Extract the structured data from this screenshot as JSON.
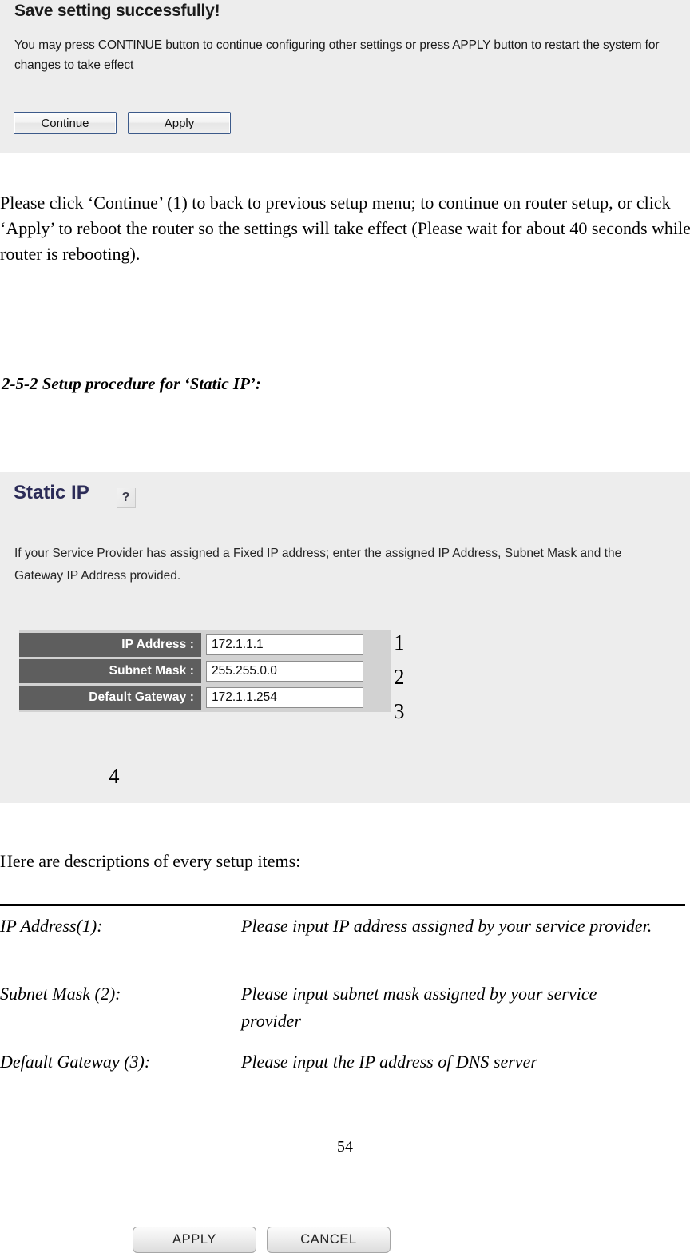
{
  "save_panel": {
    "title": "Save setting successfully!",
    "description": "You may press CONTINUE button to continue configuring other settings or press APPLY button to restart the system for changes to take effect",
    "continue_label": "Continue",
    "apply_label": "Apply"
  },
  "document": {
    "paragraph_continue": "Please click ‘Continue’ (1) to back to previous setup menu; to continue on router setup, or click ‘Apply’ to reboot the router so the settings will take effect (Please wait for about 40 seconds while router is rebooting).",
    "heading": "2-5-2 Setup procedure for ‘Static IP’:",
    "paragraph_here": "Here are descriptions of every setup items:",
    "page_number": "54"
  },
  "static_panel": {
    "title": "Static IP",
    "help_icon_glyph": "?",
    "description": "If your Service Provider has assigned a Fixed IP address; enter the assigned IP Address, Subnet Mask and the Gateway IP Address provided.",
    "fields": [
      {
        "label": "IP Address :",
        "value": "172.1.1.1",
        "annotation": "1"
      },
      {
        "label": "Subnet Mask :",
        "value": "255.255.0.0",
        "annotation": "2"
      },
      {
        "label": "Default Gateway :",
        "value": "172.1.1.254",
        "annotation": "3"
      }
    ],
    "apply_label": "APPLY",
    "cancel_label": "CANCEL",
    "buttons_annotation": "4",
    "colors": {
      "panel_background": "#ededed",
      "label_background": "#5e5e5e",
      "label_text": "#ffffff",
      "title_text": "#2c2c58",
      "input_background": "#ffffff",
      "form_backdrop": "#d2d2d2"
    }
  },
  "descriptions": [
    {
      "term": "IP Address(1):",
      "text": "Please input IP address assigned by your service provider."
    },
    {
      "term": "Subnet Mask (2):",
      "text": "Please input subnet mask assigned by your service provider"
    },
    {
      "term": "Default Gateway (3):",
      "text": "Please input the IP address of DNS server"
    }
  ]
}
